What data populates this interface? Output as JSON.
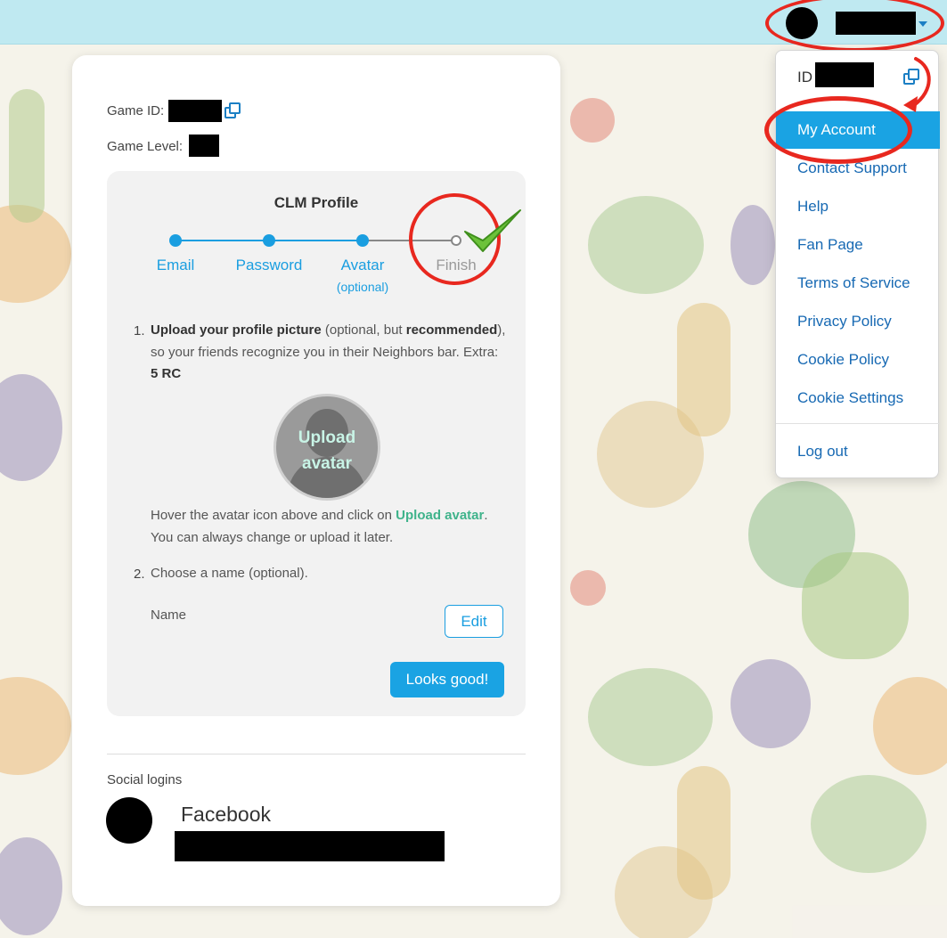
{
  "colors": {
    "topbar": "#bfe9f1",
    "accent": "#1aa3e3",
    "link": "#1769b3",
    "annotation": "#e8281f",
    "upload_link": "#3fb38b",
    "check": "#6cc23a"
  },
  "topbar": {
    "avatar": "user-avatar",
    "dropdown_icon": "caret-down-icon"
  },
  "menu": {
    "id_label": "ID",
    "copy_icon": "copy-icon",
    "items": [
      "My Account",
      "Contact Support",
      "Help",
      "Fan Page",
      "Terms of Service",
      "Privacy Policy",
      "Cookie Policy",
      "Cookie Settings",
      "Log out"
    ],
    "active_item": "My Account"
  },
  "card": {
    "game_id_label": "Game ID:",
    "game_level_label": "Game Level:",
    "profile": {
      "title": "CLM Profile",
      "steps": [
        {
          "label": "Email",
          "done": true
        },
        {
          "label": "Password",
          "done": true
        },
        {
          "label": "Avatar",
          "sub": "(optional)",
          "done": true
        },
        {
          "label": "Finish",
          "done": false
        }
      ],
      "step1": {
        "number": "1.",
        "bold1": "Upload your profile picture",
        "text1": " (optional, but ",
        "bold2": "recommended",
        "text2": "), so your friends recognize you in their Neighbors bar. Extra: ",
        "bold3": "5 RC"
      },
      "upload_label_1": "Upload",
      "upload_label_2": "avatar",
      "hover_text1": "Hover the avatar icon above and click on ",
      "hover_link": "Upload avatar",
      "hover_text2": ". You can always change or upload it later.",
      "step2_number": "2.",
      "step2_text": "Choose a name (optional).",
      "name_label": "Name",
      "edit_button": "Edit",
      "confirm_button": "Looks good!"
    },
    "social_title": "Social logins",
    "facebook_label": "Facebook"
  }
}
